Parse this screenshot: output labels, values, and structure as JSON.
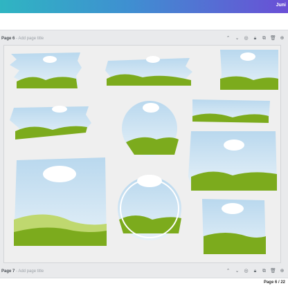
{
  "app": {
    "user_label": "Juni"
  },
  "page6": {
    "number": "Page 6",
    "title_placeholder": "Add page title"
  },
  "page7": {
    "number": "Page 7",
    "title_placeholder": "Add page title"
  },
  "page_tools": [
    {
      "name": "move-up-icon",
      "glyph": "⌃"
    },
    {
      "name": "move-down-icon",
      "glyph": "⌄"
    },
    {
      "name": "hide-icon",
      "glyph": "◎"
    },
    {
      "name": "lock-icon",
      "glyph": "🔒︎"
    },
    {
      "name": "duplicate-icon",
      "glyph": "⧉"
    },
    {
      "name": "delete-icon",
      "glyph": "🗑︎"
    },
    {
      "name": "add-page-icon",
      "glyph": "⊕"
    }
  ],
  "footer": {
    "page_count": "Page 6 / 22"
  },
  "colors": {
    "sky_top": "#b9d8ee",
    "sky_bottom": "#e6f1f8",
    "grass_dark": "#7cab1d",
    "grass_light": "#bfd86f",
    "cloud": "#ffffff"
  }
}
